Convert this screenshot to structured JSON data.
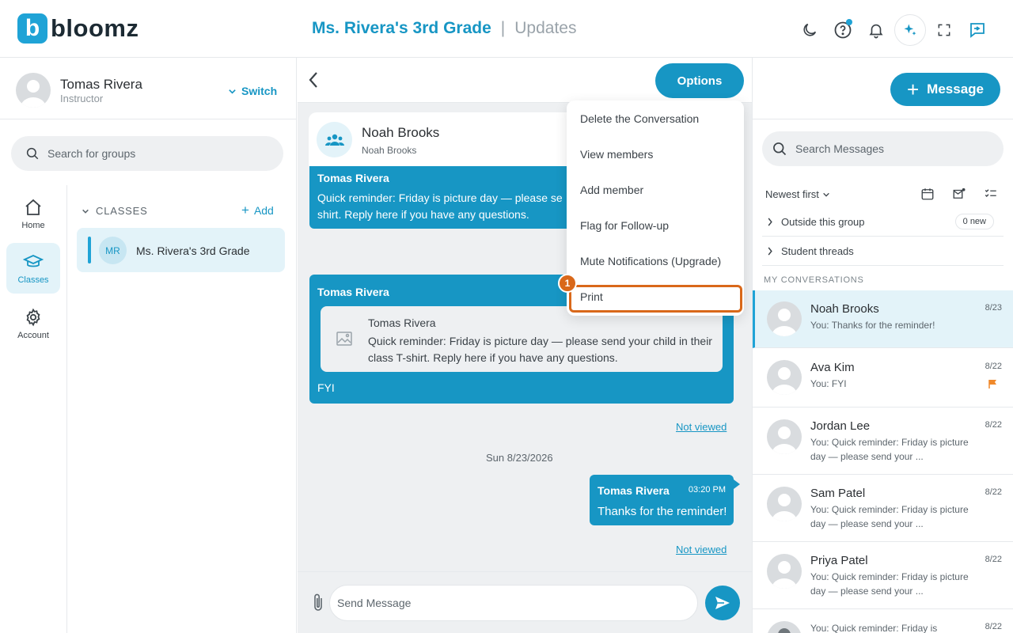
{
  "brand": {
    "logo_letter": "b",
    "name": "bloomz"
  },
  "header": {
    "group_title": "Ms. Rivera's 3rd Grade",
    "separator": "|",
    "page_title": "Updates"
  },
  "profile": {
    "name": "Tomas Rivera",
    "role": "Instructor",
    "switch_label": "Switch"
  },
  "left_search": {
    "placeholder": "Search for groups"
  },
  "nav": [
    {
      "label": "Home",
      "icon": "home-icon"
    },
    {
      "label": "Classes",
      "icon": "graduation-cap-icon",
      "active": true
    },
    {
      "label": "Account",
      "icon": "gear-icon"
    }
  ],
  "classes": {
    "heading": "CLASSES",
    "add_label": "Add",
    "items": [
      {
        "initials": "MR",
        "name": "Ms. Rivera's 3rd Grade"
      }
    ]
  },
  "chat": {
    "options_label": "Options",
    "contact": {
      "name": "Noah Brooks",
      "subtitle": "Noah Brooks"
    },
    "messages": [
      {
        "sender": "Tomas Rivera",
        "text": "Quick reminder: Friday is picture day — please se shirt. Reply here if you have any questions."
      },
      {
        "sender": "Tomas Rivera",
        "quote_sender": "Tomas Rivera",
        "quote_text": "Quick reminder: Friday is picture day — please send your child in their class T-shirt. Reply here if you have any questions.",
        "text": "FYI",
        "status": "Not viewed"
      },
      {
        "sender": "Tomas Rivera",
        "time": "03:20 PM",
        "text": "Thanks for the reminder!",
        "status": "Not viewed"
      }
    ],
    "date_separator": "Sun 8/23/2026",
    "composer_placeholder": "Send Message"
  },
  "options_menu": {
    "items": [
      "Delete the Conversation",
      "View members",
      "Add member",
      "Flag for Follow-up",
      "Mute Notifications (Upgrade)",
      "Print"
    ],
    "highlight_step": "1",
    "highlight_color": "#d9681a"
  },
  "right": {
    "new_message_label": "Message",
    "search_placeholder": "Search Messages",
    "sort_label": "Newest first",
    "groups": [
      {
        "label": "Outside this group",
        "badge": "0 new"
      },
      {
        "label": "Student threads"
      }
    ],
    "my_conversations_heading": "MY CONVERSATIONS",
    "conversations": [
      {
        "name": "Noah Brooks",
        "preview": "You: Thanks for the reminder!",
        "date": "8/23",
        "active": true
      },
      {
        "name": "Ava Kim",
        "preview": "You: FYI",
        "date": "8/22",
        "flagged": true
      },
      {
        "name": "Jordan Lee",
        "preview": "You: Quick reminder: Friday is picture day — please send your ...",
        "date": "8/22"
      },
      {
        "name": "Sam Patel",
        "preview": "You: Quick reminder: Friday is picture day — please send your ...",
        "date": "8/22"
      },
      {
        "name": "Priya Patel",
        "preview": "You: Quick reminder: Friday is picture day — please send your ...",
        "date": "8/22"
      },
      {
        "name": "",
        "preview": "You: Quick reminder: Friday is",
        "date": "8/22"
      }
    ]
  },
  "colors": {
    "accent": "#1796c4",
    "accent_light": "#e3f3f9",
    "surface": "#eef0f2",
    "flag": "#f0892b"
  }
}
